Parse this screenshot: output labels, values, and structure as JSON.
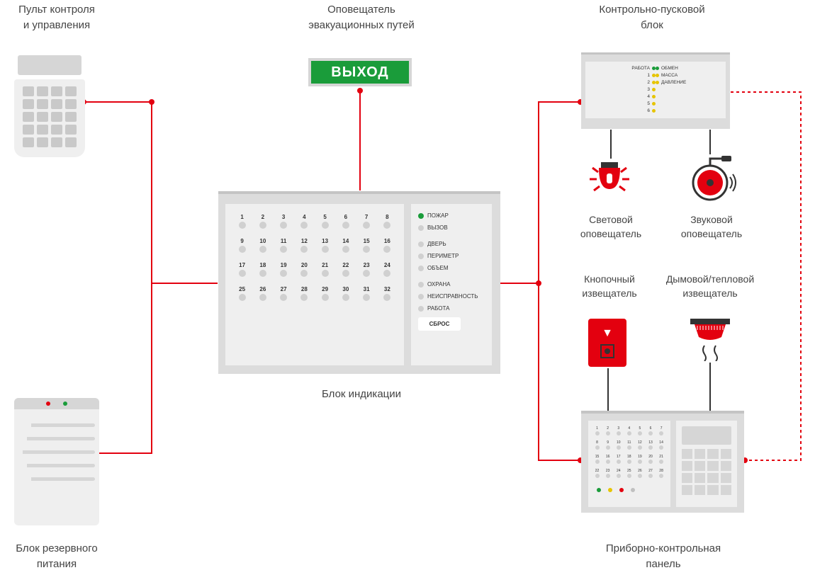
{
  "labels": {
    "keypad": "Пульт контроля\nи управления",
    "exit_sign": "Оповещатель\nэвакуационных путей",
    "ctl_block": "Контрольно-пусковой\nблок",
    "light_notifier": "Световой\nоповещатель",
    "sound_notifier": "Звуковой\nоповещатель",
    "button_detector": "Кнопочный\nизвещатель",
    "smoke_detector": "Дымовой/тепловой\nизвещатель",
    "indication_block": "Блок индикации",
    "ups": "Блок резервного\nпитания",
    "control_panel": "Приборно-контрольная\nпанель"
  },
  "exit_sign_text": "ВЫХОД",
  "ctl_block_leds": {
    "left": [
      {
        "name": "РАБОТА",
        "color": "green"
      },
      {
        "name": "1",
        "color": "yellow"
      },
      {
        "name": "2",
        "color": "yellow"
      },
      {
        "name": "3",
        "color": "yellow"
      },
      {
        "name": "4",
        "color": "yellow"
      },
      {
        "name": "5",
        "color": "yellow"
      },
      {
        "name": "6",
        "color": "yellow"
      }
    ],
    "right": [
      {
        "name": "ОБМЕН",
        "color": "green"
      },
      {
        "name": "МАССА",
        "color": "yellow"
      },
      {
        "name": "ДАВЛЕНИЕ",
        "color": "yellow"
      }
    ]
  },
  "indication": {
    "zones": [
      "1",
      "2",
      "3",
      "4",
      "5",
      "6",
      "7",
      "8",
      "9",
      "10",
      "11",
      "12",
      "13",
      "14",
      "15",
      "16",
      "17",
      "18",
      "19",
      "20",
      "21",
      "22",
      "23",
      "24",
      "25",
      "26",
      "27",
      "28",
      "29",
      "30",
      "31",
      "32"
    ],
    "statuses": [
      {
        "name": "ПОЖАР",
        "active": true
      },
      {
        "name": "ВЫЗОВ",
        "active": false
      },
      {
        "name": "ДВЕРЬ",
        "active": false
      },
      {
        "name": "ПЕРИМЕТР",
        "active": false
      },
      {
        "name": "ОБЪЕМ",
        "active": false
      },
      {
        "name": "ОХРАНА",
        "active": false
      },
      {
        "name": "НЕИСПРАВНОСТЬ",
        "active": false
      },
      {
        "name": "РАБОТА",
        "active": false
      }
    ],
    "reset_label": "СБРОС"
  },
  "panel": {
    "zones": [
      "1",
      "2",
      "3",
      "4",
      "5",
      "6",
      "7",
      "8",
      "9",
      "10",
      "11",
      "12",
      "13",
      "14",
      "15",
      "16",
      "17",
      "18",
      "19",
      "20",
      "21",
      "22",
      "23",
      "24",
      "25",
      "26",
      "27",
      "28"
    ],
    "bottom_leds": [
      "green",
      "yellow",
      "red",
      "grey"
    ]
  },
  "colors": {
    "wire": "#e3000f",
    "accent_green": "#1a9c3a",
    "device_grey": "#dcdcdc"
  }
}
